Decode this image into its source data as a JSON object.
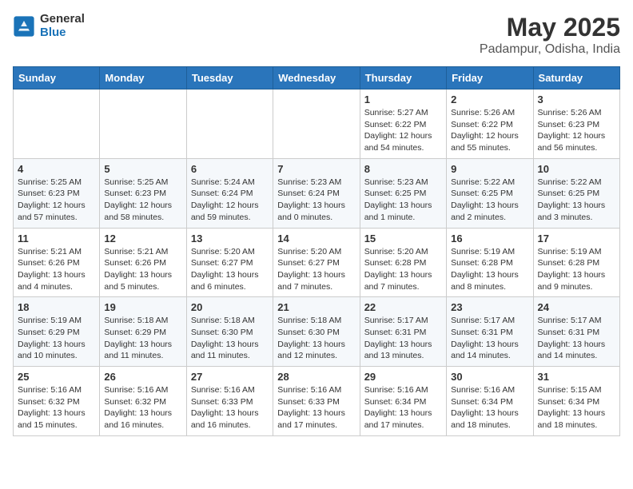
{
  "header": {
    "logo_general": "General",
    "logo_blue": "Blue",
    "month_title": "May 2025",
    "location": "Padampur, Odisha, India"
  },
  "weekdays": [
    "Sunday",
    "Monday",
    "Tuesday",
    "Wednesday",
    "Thursday",
    "Friday",
    "Saturday"
  ],
  "weeks": [
    [
      null,
      null,
      null,
      null,
      {
        "day": "1",
        "sunrise": "5:27 AM",
        "sunset": "6:22 PM",
        "daylight": "12 hours and 54 minutes."
      },
      {
        "day": "2",
        "sunrise": "5:26 AM",
        "sunset": "6:22 PM",
        "daylight": "12 hours and 55 minutes."
      },
      {
        "day": "3",
        "sunrise": "5:26 AM",
        "sunset": "6:23 PM",
        "daylight": "12 hours and 56 minutes."
      }
    ],
    [
      {
        "day": "4",
        "sunrise": "5:25 AM",
        "sunset": "6:23 PM",
        "daylight": "12 hours and 57 minutes."
      },
      {
        "day": "5",
        "sunrise": "5:25 AM",
        "sunset": "6:23 PM",
        "daylight": "12 hours and 58 minutes."
      },
      {
        "day": "6",
        "sunrise": "5:24 AM",
        "sunset": "6:24 PM",
        "daylight": "12 hours and 59 minutes."
      },
      {
        "day": "7",
        "sunrise": "5:23 AM",
        "sunset": "6:24 PM",
        "daylight": "13 hours and 0 minutes."
      },
      {
        "day": "8",
        "sunrise": "5:23 AM",
        "sunset": "6:25 PM",
        "daylight": "13 hours and 1 minute."
      },
      {
        "day": "9",
        "sunrise": "5:22 AM",
        "sunset": "6:25 PM",
        "daylight": "13 hours and 2 minutes."
      },
      {
        "day": "10",
        "sunrise": "5:22 AM",
        "sunset": "6:25 PM",
        "daylight": "13 hours and 3 minutes."
      }
    ],
    [
      {
        "day": "11",
        "sunrise": "5:21 AM",
        "sunset": "6:26 PM",
        "daylight": "13 hours and 4 minutes."
      },
      {
        "day": "12",
        "sunrise": "5:21 AM",
        "sunset": "6:26 PM",
        "daylight": "13 hours and 5 minutes."
      },
      {
        "day": "13",
        "sunrise": "5:20 AM",
        "sunset": "6:27 PM",
        "daylight": "13 hours and 6 minutes."
      },
      {
        "day": "14",
        "sunrise": "5:20 AM",
        "sunset": "6:27 PM",
        "daylight": "13 hours and 7 minutes."
      },
      {
        "day": "15",
        "sunrise": "5:20 AM",
        "sunset": "6:28 PM",
        "daylight": "13 hours and 7 minutes."
      },
      {
        "day": "16",
        "sunrise": "5:19 AM",
        "sunset": "6:28 PM",
        "daylight": "13 hours and 8 minutes."
      },
      {
        "day": "17",
        "sunrise": "5:19 AM",
        "sunset": "6:28 PM",
        "daylight": "13 hours and 9 minutes."
      }
    ],
    [
      {
        "day": "18",
        "sunrise": "5:19 AM",
        "sunset": "6:29 PM",
        "daylight": "13 hours and 10 minutes."
      },
      {
        "day": "19",
        "sunrise": "5:18 AM",
        "sunset": "6:29 PM",
        "daylight": "13 hours and 11 minutes."
      },
      {
        "day": "20",
        "sunrise": "5:18 AM",
        "sunset": "6:30 PM",
        "daylight": "13 hours and 11 minutes."
      },
      {
        "day": "21",
        "sunrise": "5:18 AM",
        "sunset": "6:30 PM",
        "daylight": "13 hours and 12 minutes."
      },
      {
        "day": "22",
        "sunrise": "5:17 AM",
        "sunset": "6:31 PM",
        "daylight": "13 hours and 13 minutes."
      },
      {
        "day": "23",
        "sunrise": "5:17 AM",
        "sunset": "6:31 PM",
        "daylight": "13 hours and 14 minutes."
      },
      {
        "day": "24",
        "sunrise": "5:17 AM",
        "sunset": "6:31 PM",
        "daylight": "13 hours and 14 minutes."
      }
    ],
    [
      {
        "day": "25",
        "sunrise": "5:16 AM",
        "sunset": "6:32 PM",
        "daylight": "13 hours and 15 minutes."
      },
      {
        "day": "26",
        "sunrise": "5:16 AM",
        "sunset": "6:32 PM",
        "daylight": "13 hours and 16 minutes."
      },
      {
        "day": "27",
        "sunrise": "5:16 AM",
        "sunset": "6:33 PM",
        "daylight": "13 hours and 16 minutes."
      },
      {
        "day": "28",
        "sunrise": "5:16 AM",
        "sunset": "6:33 PM",
        "daylight": "13 hours and 17 minutes."
      },
      {
        "day": "29",
        "sunrise": "5:16 AM",
        "sunset": "6:34 PM",
        "daylight": "13 hours and 17 minutes."
      },
      {
        "day": "30",
        "sunrise": "5:16 AM",
        "sunset": "6:34 PM",
        "daylight": "13 hours and 18 minutes."
      },
      {
        "day": "31",
        "sunrise": "5:15 AM",
        "sunset": "6:34 PM",
        "daylight": "13 hours and 18 minutes."
      }
    ]
  ],
  "labels": {
    "sunrise": "Sunrise:",
    "sunset": "Sunset:",
    "daylight": "Daylight:"
  }
}
